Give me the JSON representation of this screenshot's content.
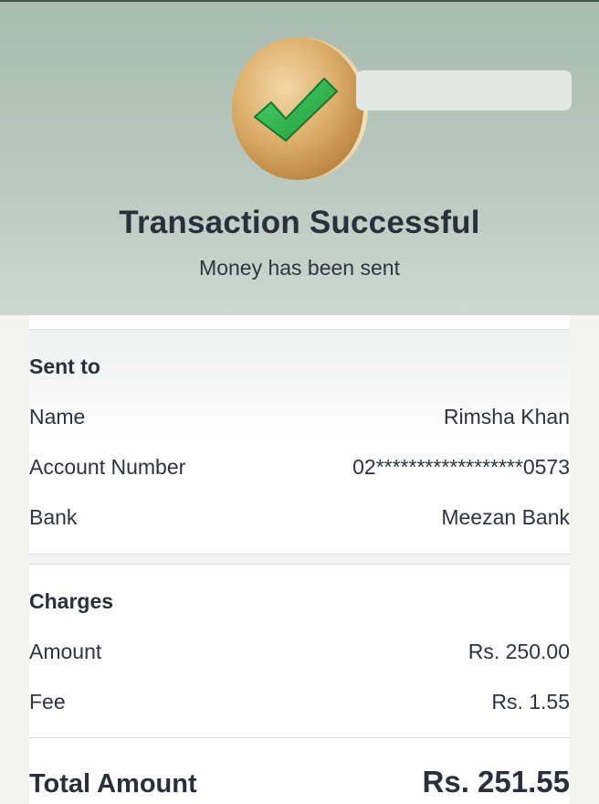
{
  "header": {
    "title": "Transaction Successful",
    "subtitle": "Money has been sent",
    "icon": "check-coin-icon"
  },
  "sent_to": {
    "section_title": "Sent to",
    "name_label": "Name",
    "name_value": "Rimsha Khan",
    "account_label": "Account Number",
    "account_value": "02******************0573",
    "bank_label": "Bank",
    "bank_value": "Meezan Bank"
  },
  "charges": {
    "section_title": "Charges",
    "amount_label": "Amount",
    "amount_value": "Rs. 250.00",
    "fee_label": "Fee",
    "fee_value": "Rs. 1.55"
  },
  "total": {
    "label": "Total Amount",
    "value": "Rs. 251.55"
  },
  "colors": {
    "header_bg": "#b9c8be",
    "check_green": "#2fb24a",
    "coin_gold": "#d9a85e",
    "text": "#2b2f3c"
  }
}
